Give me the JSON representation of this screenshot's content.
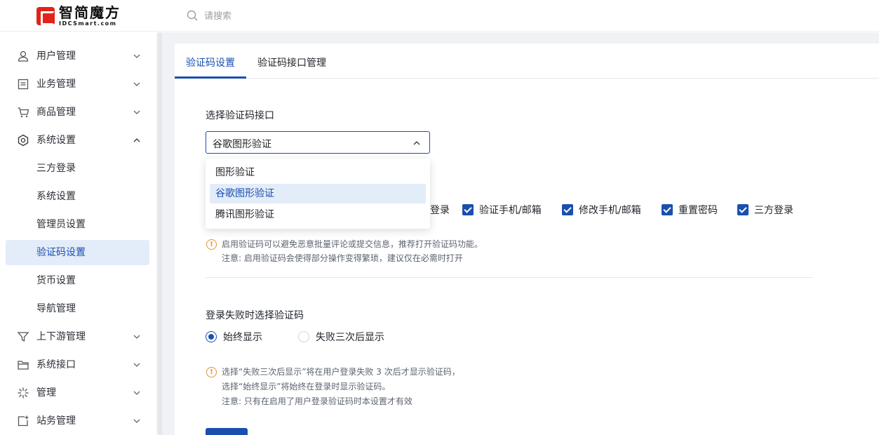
{
  "brand": {
    "name_cn": "智简魔方",
    "name_en": "IDCSmart.com",
    "color": "#e0241a"
  },
  "search": {
    "placeholder": "请搜索"
  },
  "sidebar": {
    "items": [
      {
        "label": "用户管理",
        "icon": "user-icon"
      },
      {
        "label": "业务管理",
        "icon": "document-icon"
      },
      {
        "label": "商品管理",
        "icon": "cart-icon"
      },
      {
        "label": "系统设置",
        "icon": "settings-icon",
        "expanded": true
      },
      {
        "label": "上下游管理",
        "icon": "filter-icon"
      },
      {
        "label": "系统接口",
        "icon": "folder-icon"
      },
      {
        "label": "管理",
        "icon": "sparkle-icon"
      },
      {
        "label": "站务管理",
        "icon": "site-icon"
      }
    ],
    "sub_items": [
      "三方登录",
      "系统设置",
      "管理员设置",
      "验证码设置",
      "货币设置",
      "导航管理"
    ],
    "active_sub": "验证码设置"
  },
  "tabs": [
    {
      "label": "验证码设置",
      "active": true
    },
    {
      "label": "验证码接口管理",
      "active": false
    }
  ],
  "captcha_interface": {
    "label": "选择验证码接口",
    "selected": "谷歌图形验证",
    "options": [
      "图形验证",
      "谷歌图形验证",
      "腾讯图形验证"
    ]
  },
  "scenes": {
    "partial_label_visible": "登录",
    "checked": [
      "验证手机/邮箱",
      "修改手机/邮箱",
      "重置密码",
      "三方登录"
    ]
  },
  "hint1": {
    "line1": "启用验证码可以避免恶意批量评论或提交信息，推荐打开验证码功能。",
    "line2": "注意: 启用验证码会使得部分操作变得繁琐，建议仅在必需时打开"
  },
  "login_fail": {
    "label": "登录失败时选择验证码",
    "options": [
      "始终显示",
      "失败三次后显示"
    ],
    "selected": "始终显示"
  },
  "hint2": {
    "line1": "选择“失败三次后显示”将在用户登录失败 3 次后才显示验证码，",
    "line2": "选择“始终显示”将始终在登录时显示验证码。",
    "line3": "注意: 只有在启用了用户登录验证码时本设置才有效"
  },
  "colors": {
    "primary": "#1a4fae",
    "warning": "#e8902c",
    "active_bg": "#e3ecf9"
  }
}
